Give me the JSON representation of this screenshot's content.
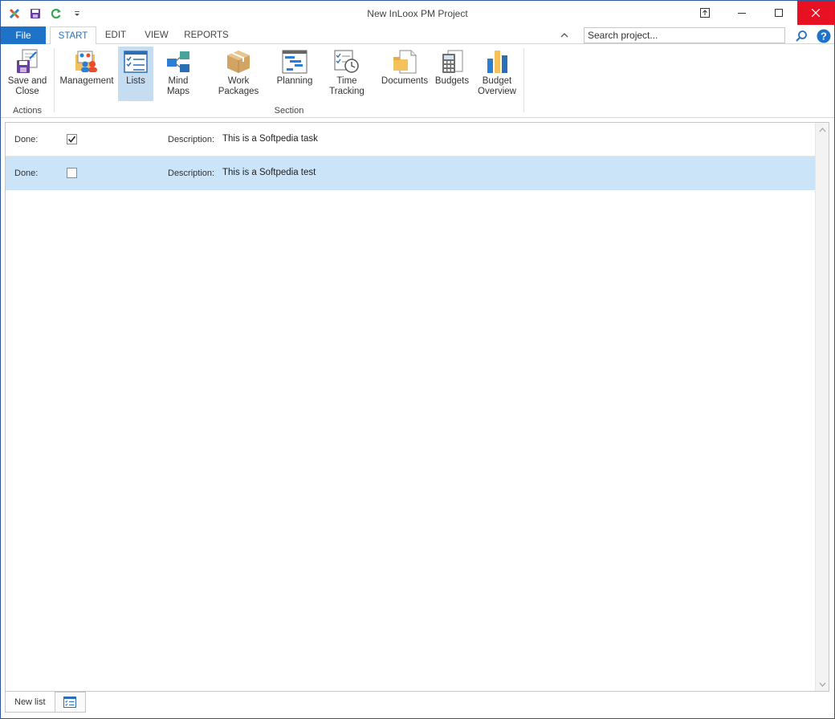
{
  "window": {
    "title": "New InLoox PM Project"
  },
  "qat": {
    "icons": [
      "inloox-logo-icon",
      "save-icon",
      "refresh-icon",
      "customize-dropdown-icon"
    ]
  },
  "tabs": {
    "file": "File",
    "items": [
      {
        "label": "START",
        "active": true
      },
      {
        "label": "EDIT",
        "active": false
      },
      {
        "label": "VIEW",
        "active": false
      },
      {
        "label": "REPORTS",
        "active": false
      }
    ]
  },
  "search": {
    "placeholder": "Search project..."
  },
  "ribbon": {
    "actions": {
      "group_label": "Actions",
      "save_close": "Save and\nClose"
    },
    "section": {
      "group_label": "Section",
      "buttons": [
        {
          "label": "Management",
          "icon": "management-icon"
        },
        {
          "label": "Lists",
          "icon": "lists-icon",
          "selected": true
        },
        {
          "label": "Mind Maps",
          "icon": "mind-maps-icon"
        },
        {
          "label": "Work Packages",
          "icon": "work-packages-icon"
        },
        {
          "label": "Planning",
          "icon": "planning-icon"
        },
        {
          "label": "Time Tracking",
          "icon": "time-tracking-icon"
        },
        {
          "label": "Documents",
          "icon": "documents-icon"
        },
        {
          "label": "Budgets",
          "icon": "budgets-icon"
        },
        {
          "label": "Budget\nOverview",
          "icon": "budget-overview-icon"
        }
      ]
    }
  },
  "list": {
    "done_label": "Done:",
    "description_label": "Description:",
    "rows": [
      {
        "done": true,
        "description": "This is a Softpedia task",
        "selected": false
      },
      {
        "done": false,
        "description": "This is a Softpedia test",
        "selected": true
      }
    ]
  },
  "sheet_tabs": {
    "active": "New list"
  },
  "colors": {
    "accent": "#1e73c8",
    "selection": "#cce4f7",
    "close": "#e81123"
  }
}
